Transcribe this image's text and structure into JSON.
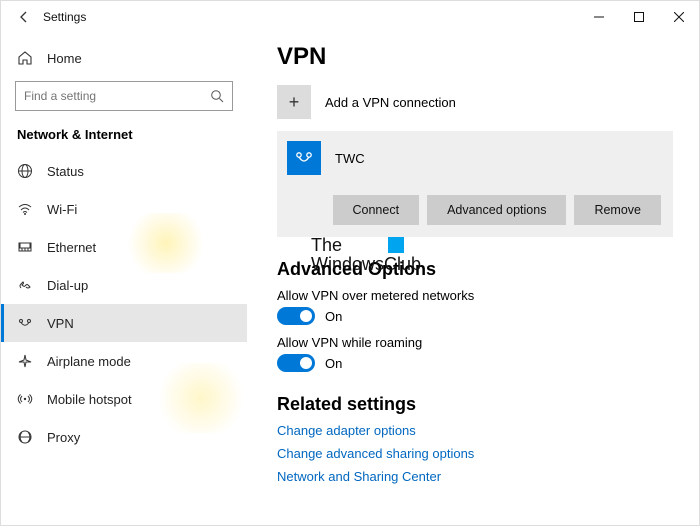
{
  "window": {
    "title": "Settings"
  },
  "sidebar": {
    "home": "Home",
    "search_placeholder": "Find a setting",
    "category": "Network & Internet",
    "items": [
      {
        "label": "Status"
      },
      {
        "label": "Wi-Fi"
      },
      {
        "label": "Ethernet"
      },
      {
        "label": "Dial-up"
      },
      {
        "label": "VPN"
      },
      {
        "label": "Airplane mode"
      },
      {
        "label": "Mobile hotspot"
      },
      {
        "label": "Proxy"
      }
    ]
  },
  "page": {
    "title": "VPN",
    "add_label": "Add a VPN connection",
    "entry": {
      "name": "TWC",
      "buttons": {
        "connect": "Connect",
        "advanced": "Advanced options",
        "remove": "Remove"
      }
    },
    "adv_heading": "Advanced Options",
    "opt1_label": "Allow VPN over metered networks",
    "opt1_state": "On",
    "opt2_label": "Allow VPN while roaming",
    "opt2_state": "On",
    "related_heading": "Related settings",
    "links": {
      "l1": "Change adapter options",
      "l2": "Change advanced sharing options",
      "l3": "Network and Sharing Center"
    }
  },
  "watermark": {
    "line1": "The",
    "line2": "WindowsClub"
  }
}
